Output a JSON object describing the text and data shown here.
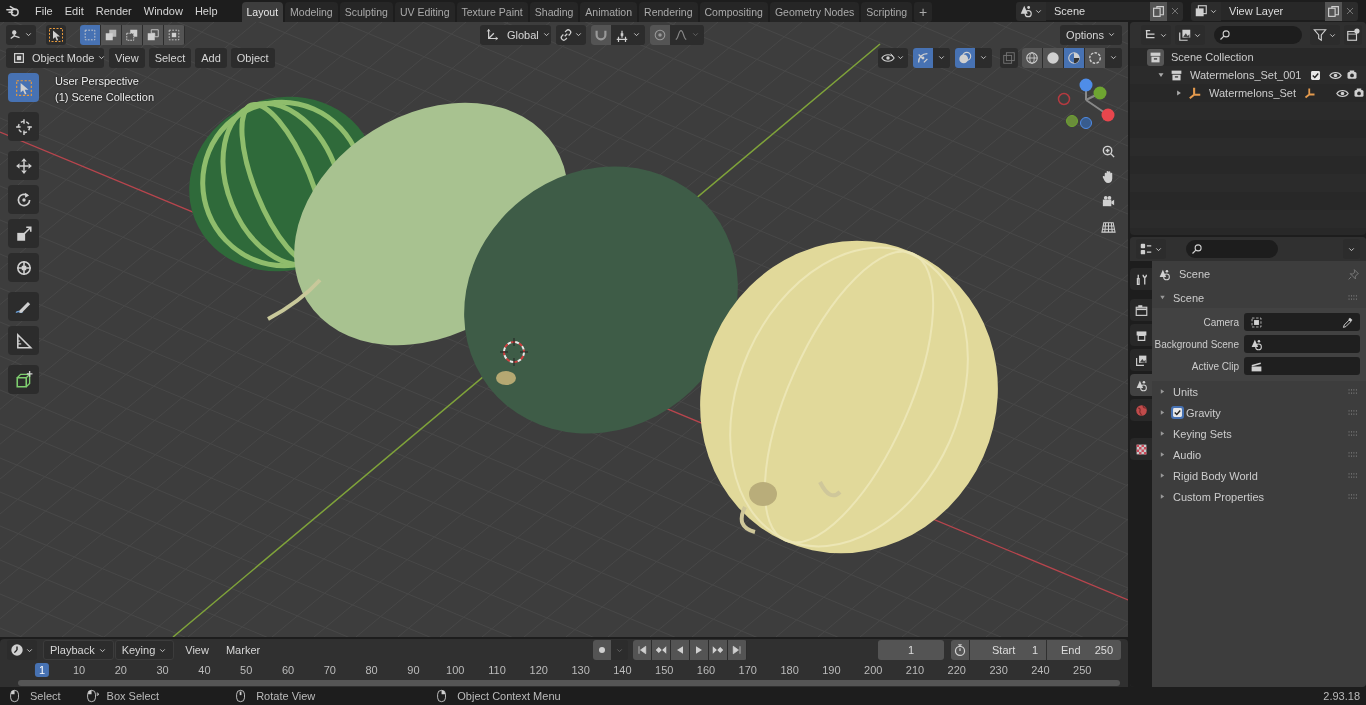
{
  "topbar": {
    "menus": [
      "File",
      "Edit",
      "Render",
      "Window",
      "Help"
    ],
    "workspaces": [
      {
        "label": "Layout",
        "selected": true
      },
      {
        "label": "Modeling",
        "selected": false
      },
      {
        "label": "Sculpting",
        "selected": false
      },
      {
        "label": "UV Editing",
        "selected": false
      },
      {
        "label": "Texture Paint",
        "selected": false
      },
      {
        "label": "Shading",
        "selected": false
      },
      {
        "label": "Animation",
        "selected": false
      },
      {
        "label": "Rendering",
        "selected": false
      },
      {
        "label": "Compositing",
        "selected": false
      },
      {
        "label": "Geometry Nodes",
        "selected": false
      },
      {
        "label": "Scripting",
        "selected": false
      }
    ],
    "add_tab": "+",
    "scene": "Scene",
    "view_layer": "View Layer"
  },
  "viewport": {
    "select_modes": [
      {
        "kind": "set",
        "selected": true
      },
      {
        "kind": "extend",
        "selected": false
      },
      {
        "kind": "subtract",
        "selected": false
      },
      {
        "kind": "invert",
        "selected": false
      },
      {
        "kind": "intersect",
        "selected": false
      }
    ],
    "orientation": "Global",
    "options": "Options",
    "mode": "Object Mode",
    "menus": [
      "View",
      "Select",
      "Add",
      "Object"
    ],
    "gizmos_on": true,
    "overlays_on": true,
    "xray_on": false,
    "shading": [
      {
        "kind": "wireframe",
        "selected": false
      },
      {
        "kind": "solid",
        "selected": false
      },
      {
        "kind": "material",
        "selected": true
      },
      {
        "kind": "rendered",
        "selected": false
      }
    ],
    "overlay_text": [
      "User Perspective",
      "(1) Scene Collection"
    ],
    "tools": [
      {
        "kind": "select",
        "selected": true
      },
      {
        "kind": "cursor",
        "selected": false
      },
      {
        "kind": "move",
        "selected": false
      },
      {
        "kind": "rotate",
        "selected": false
      },
      {
        "kind": "scale",
        "selected": false
      },
      {
        "kind": "transform",
        "selected": false
      },
      {
        "kind": "annotate",
        "selected": false
      },
      {
        "kind": "measure",
        "selected": false
      },
      {
        "kind": "add_cube",
        "selected": false
      }
    ]
  },
  "outliner": {
    "items": [
      {
        "label": "Scene Collection",
        "kind": "scene_collection",
        "children": [
          {
            "label": "Watermelons_Set_001",
            "kind": "collection",
            "expanded": true,
            "checked": true,
            "children": [
              {
                "label": "Watermelons_Set",
                "kind": "empty",
                "expanded": false
              }
            ]
          }
        ]
      }
    ]
  },
  "properties": {
    "tabs": [
      {
        "kind": "tool",
        "selected": false
      },
      {
        "kind": "render",
        "selected": false
      },
      {
        "kind": "output",
        "selected": false
      },
      {
        "kind": "view_layer",
        "selected": false
      },
      {
        "kind": "scene",
        "selected": true
      },
      {
        "kind": "world",
        "selected": false
      },
      {
        "kind": "texture",
        "selected": false
      }
    ],
    "context": "Scene",
    "panels": [
      {
        "title": "Scene",
        "kind": "plain",
        "expanded": true,
        "fields": [
          {
            "label": "Camera",
            "kind": "camera"
          },
          {
            "label": "Background Scene",
            "kind": "scene"
          },
          {
            "label": "Active Clip",
            "kind": "clip"
          }
        ]
      },
      {
        "title": "Units",
        "kind": "plain",
        "expanded": false
      },
      {
        "title": "Gravity",
        "kind": "checkbox",
        "checked": true,
        "expanded": false
      },
      {
        "title": "Keying Sets",
        "kind": "plain",
        "expanded": false
      },
      {
        "title": "Audio",
        "kind": "plain",
        "expanded": false
      },
      {
        "title": "Rigid Body World",
        "kind": "plain",
        "expanded": false
      },
      {
        "title": "Custom Properties",
        "kind": "plain",
        "expanded": false
      }
    ]
  },
  "timeline": {
    "menus": [
      {
        "label": "Playback",
        "kind": "dropdown"
      },
      {
        "label": "Keying",
        "kind": "dropdown"
      },
      {
        "label": "View",
        "kind": "menu"
      },
      {
        "label": "Marker",
        "kind": "menu"
      }
    ],
    "current_frame": "1",
    "start": {
      "label": "Start",
      "value": "1"
    },
    "end": {
      "label": "End",
      "value": "250"
    },
    "ticks": [
      {
        "label": "1",
        "current": true
      },
      {
        "label": "10",
        "current": false
      },
      {
        "label": "20",
        "current": false
      },
      {
        "label": "30",
        "current": false
      },
      {
        "label": "40",
        "current": false
      },
      {
        "label": "50",
        "current": false
      },
      {
        "label": "60",
        "current": false
      },
      {
        "label": "70",
        "current": false
      },
      {
        "label": "80",
        "current": false
      },
      {
        "label": "90",
        "current": false
      },
      {
        "label": "100",
        "current": false
      },
      {
        "label": "110",
        "current": false
      },
      {
        "label": "120",
        "current": false
      },
      {
        "label": "130",
        "current": false
      },
      {
        "label": "140",
        "current": false
      },
      {
        "label": "150",
        "current": false
      },
      {
        "label": "160",
        "current": false
      },
      {
        "label": "170",
        "current": false
      },
      {
        "label": "180",
        "current": false
      },
      {
        "label": "190",
        "current": false
      },
      {
        "label": "200",
        "current": false
      },
      {
        "label": "210",
        "current": false
      },
      {
        "label": "220",
        "current": false
      },
      {
        "label": "230",
        "current": false
      },
      {
        "label": "240",
        "current": false
      },
      {
        "label": "250",
        "current": false
      }
    ]
  },
  "status_bar": {
    "hints": [
      {
        "kind": "left_click",
        "label": "Select"
      },
      {
        "kind": "left_drag",
        "label": "Box Select"
      },
      {
        "kind": "middle_drag",
        "label": "Rotate View"
      },
      {
        "kind": "right_click",
        "label": "Object Context Menu"
      }
    ],
    "version": "2.93.18"
  }
}
